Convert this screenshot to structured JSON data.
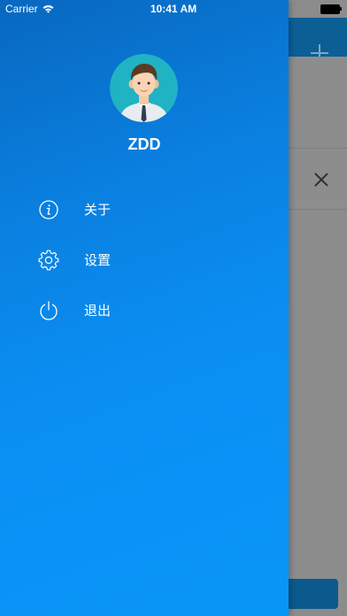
{
  "status_bar": {
    "carrier": "Carrier",
    "time": "10:41 AM",
    "icons": [
      "wifi-icon",
      "battery-icon"
    ]
  },
  "drawer": {
    "user_name": "ZDD",
    "menu": [
      {
        "label": "关于",
        "icon": "info-icon"
      },
      {
        "label": "设置",
        "icon": "gear-icon"
      },
      {
        "label": "退出",
        "icon": "power-icon"
      }
    ],
    "gradient_colors": [
      "#0868bf",
      "#0896f6"
    ]
  },
  "background_app": {
    "icons": [
      "plus-icon",
      "close-icon"
    ],
    "navbar_color": "#0c5f95"
  }
}
